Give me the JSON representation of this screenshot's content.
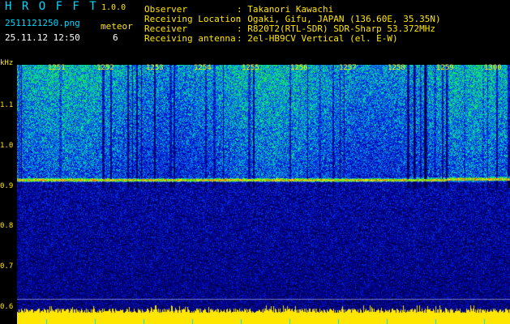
{
  "app": {
    "title": "H R O F F T",
    "version": "1.0.0",
    "filename": "2511121250.png",
    "meteor_label": "meteor",
    "meteor_count": "6",
    "datetime": "25.11.12 12:50"
  },
  "info": [
    {
      "label": "Observer",
      "value": ": Takanori Kawachi"
    },
    {
      "label": "Receiving Location",
      "value": ": Ogaki, Gifu, JAPAN (136.60E, 35.35N)"
    },
    {
      "label": "Receiver",
      "value": ": R820T2(RTL-SDR) SDR-Sharp 53.372MHz"
    },
    {
      "label": "Receiving antenna",
      "value": ": 2el-HB9CV Vertical (el. E-W)"
    }
  ],
  "axis": {
    "unit": "kHz",
    "y_ticks": [
      "1.1",
      "1.0",
      "0.9",
      "0.8",
      "0.7",
      "0.6"
    ],
    "time_ticks": [
      "1251",
      "1252",
      "1253",
      "1254",
      "1255",
      "1256",
      "1257",
      "1258",
      "1259",
      "1300"
    ]
  },
  "colors": {
    "title": "#00d8ff",
    "labels": "#ffe600",
    "background": "#000000",
    "signal_line": "#ff4040"
  }
}
